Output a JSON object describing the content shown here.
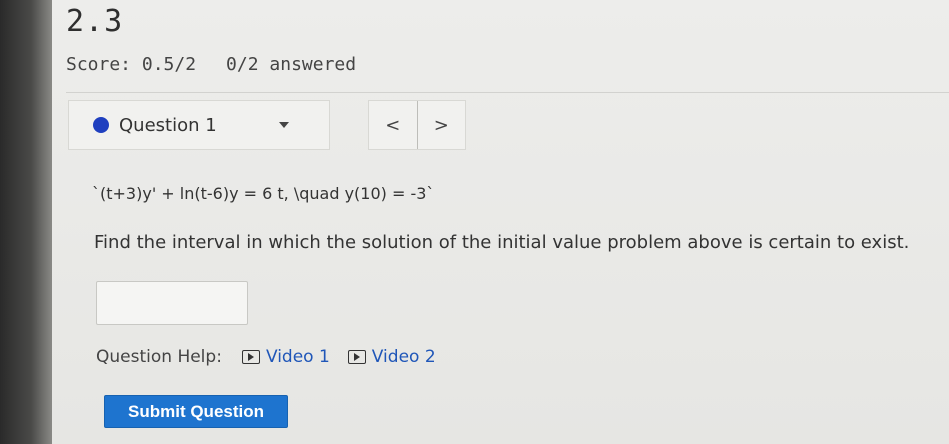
{
  "section": {
    "title": "2.3"
  },
  "score": {
    "label": "Score: 0.5/2",
    "answered": "0/2 answered"
  },
  "question_nav": {
    "current": "Question 1",
    "prev_label": "<",
    "next_label": ">"
  },
  "question": {
    "equation": "`(t+3)y' + ln(t-6)y = 6 t, \\quad y(10) = -3`",
    "prompt": "Find the interval in which the solution of the initial value problem above is certain to exist."
  },
  "answer": {
    "value": ""
  },
  "help": {
    "label": "Question Help:",
    "videos": [
      "Video 1",
      "Video 2"
    ]
  },
  "submit": {
    "label": "Submit Question"
  },
  "colors": {
    "accent": "#1e74cf",
    "link": "#1f56b8",
    "status_dot": "#1f3fbf"
  },
  "icons": {
    "dropdown": "chevron-down-icon",
    "video": "video-play-icon",
    "status": "dot-icon"
  }
}
